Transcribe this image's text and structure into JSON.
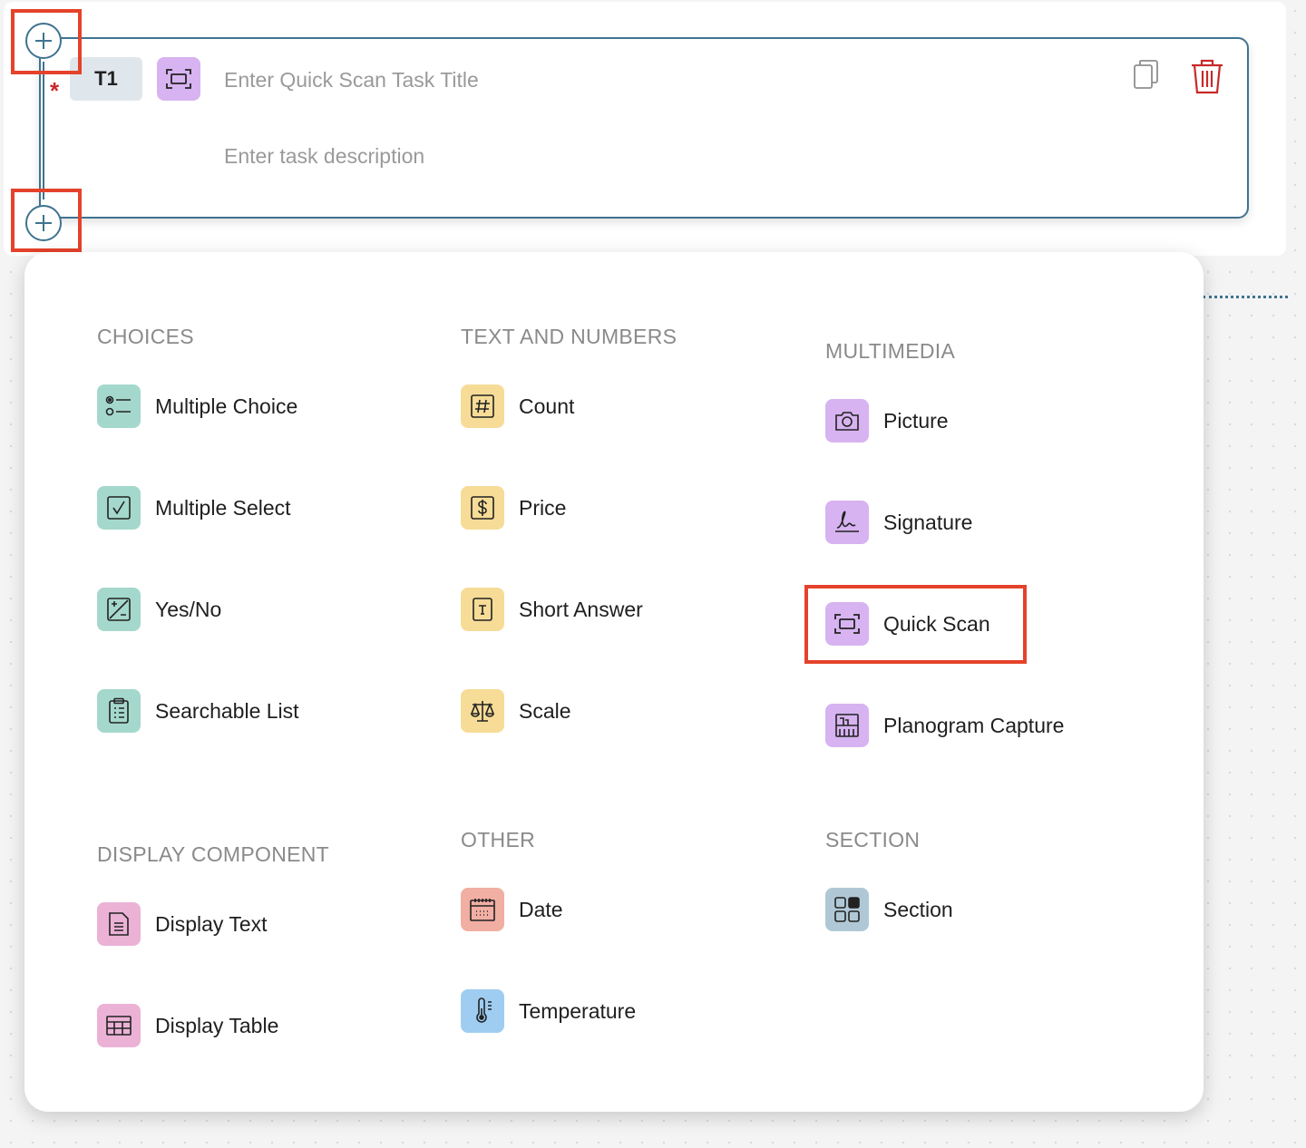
{
  "task": {
    "badge": "T1",
    "required_marker": "*",
    "type_icon": "quick-scan-icon",
    "title_placeholder": "Enter Quick Scan Task Title",
    "title_value": "",
    "description_placeholder": "Enter task description",
    "description_value": "",
    "actions": {
      "copy_icon": "copy-icon",
      "delete_icon": "trash-icon",
      "delete_color": "#c72a2a"
    }
  },
  "theme": {
    "accent": "#3f7390",
    "highlight": "#e5422b"
  },
  "menu": {
    "choices": {
      "title": "CHOICES",
      "items": [
        {
          "label": "Multiple Choice",
          "icon": "multiple-choice-icon",
          "color": "#a5d8cc"
        },
        {
          "label": "Multiple Select",
          "icon": "checkbox-icon",
          "color": "#a5d8cc"
        },
        {
          "label": "Yes/No",
          "icon": "plus-minus-icon",
          "color": "#a5d8cc"
        },
        {
          "label": "Searchable List",
          "icon": "clipboard-list-icon",
          "color": "#a5d8cc"
        }
      ]
    },
    "text_numbers": {
      "title": "TEXT AND NUMBERS",
      "items": [
        {
          "label": "Count",
          "icon": "hash-icon",
          "color": "#f6dc97"
        },
        {
          "label": "Price",
          "icon": "dollar-icon",
          "color": "#f6dc97"
        },
        {
          "label": "Short Answer",
          "icon": "text-icon",
          "color": "#f6dc97"
        },
        {
          "label": "Scale",
          "icon": "scale-icon",
          "color": "#f6dc97"
        }
      ]
    },
    "multimedia": {
      "title": "MULTIMEDIA",
      "items": [
        {
          "label": "Picture",
          "icon": "camera-icon",
          "color": "#d7b3f1"
        },
        {
          "label": "Signature",
          "icon": "signature-icon",
          "color": "#d7b3f1"
        },
        {
          "label": "Quick Scan",
          "icon": "quick-scan-icon",
          "color": "#d7b3f1"
        },
        {
          "label": "Planogram Capture",
          "icon": "planogram-icon",
          "color": "#d7b3f1"
        }
      ]
    },
    "display_component": {
      "title": "DISPLAY COMPONENT",
      "items": [
        {
          "label": "Display Text",
          "icon": "document-icon",
          "color": "#ebb2d6"
        },
        {
          "label": "Display Table",
          "icon": "table-icon",
          "color": "#ebb2d6"
        }
      ]
    },
    "other": {
      "title": "OTHER",
      "items": [
        {
          "label": "Date",
          "icon": "calendar-icon",
          "color": "#f1aea2"
        },
        {
          "label": "Temperature",
          "icon": "thermometer-icon",
          "color": "#9fcdf1"
        }
      ]
    },
    "section": {
      "title": "SECTION",
      "items": [
        {
          "label": "Section",
          "icon": "section-grid-icon",
          "color": "#b0c8d6"
        }
      ]
    }
  }
}
